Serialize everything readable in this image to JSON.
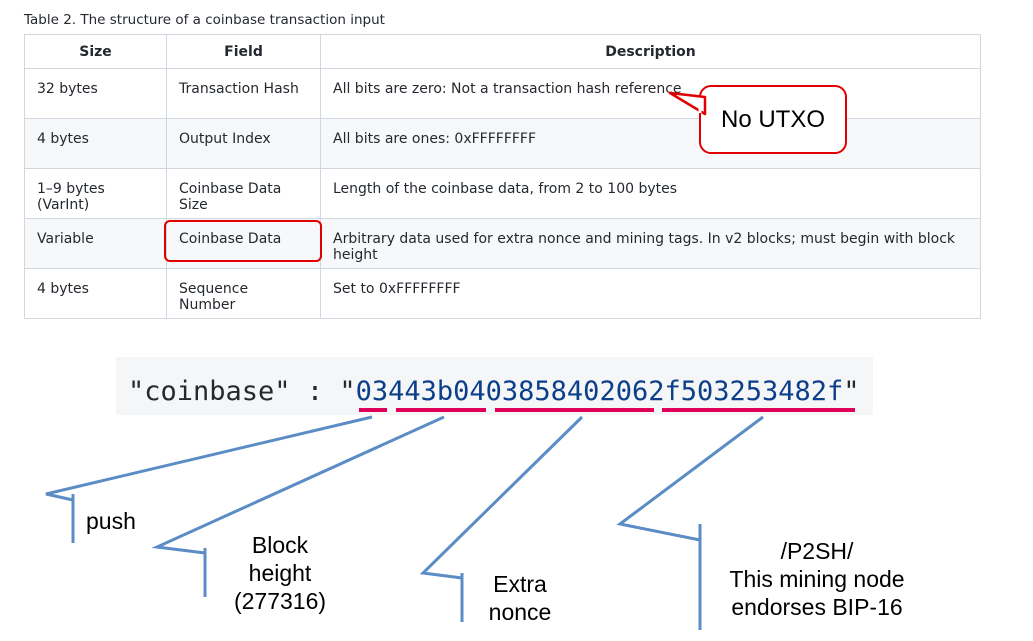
{
  "caption": "Table 2. The structure of a coinbase transaction input",
  "table": {
    "headers": [
      "Size",
      "Field",
      "Description"
    ],
    "rows": [
      [
        "32 bytes",
        "Transaction Hash",
        "All bits are zero: Not a transaction hash reference"
      ],
      [
        "4 bytes",
        "Output Index",
        "All bits are ones: 0xFFFFFFFF"
      ],
      [
        "1–9 bytes (VarInt)",
        "Coinbase Data Size",
        "Length of the coinbase data, from 2 to 100 bytes"
      ],
      [
        "Variable",
        "Coinbase Data",
        "Arbitrary data used for extra nonce and mining tags. In v2 blocks; must begin with block height"
      ],
      [
        "4 bytes",
        "Sequence Number",
        "Set to 0xFFFFFFFF"
      ]
    ]
  },
  "callout": {
    "text": "No UTXO"
  },
  "code": {
    "key": "\"coinbase\"",
    "separator": " : ",
    "open_quote": "\"",
    "hex": "03443b0403858402062f503253482f",
    "close_quote": "\""
  },
  "annotations": {
    "push": "push",
    "block_height_1": "Block",
    "block_height_2": "height",
    "block_height_3": "(277316)",
    "extra_nonce_1": "Extra",
    "extra_nonce_2": "nonce",
    "p2sh_1": "/P2SH/",
    "p2sh_2": "This mining node",
    "p2sh_3": "endorses BIP-16"
  },
  "colors": {
    "highlight": "#e00000",
    "underline": "#e0005a",
    "arrow": "#5b8cc6"
  }
}
